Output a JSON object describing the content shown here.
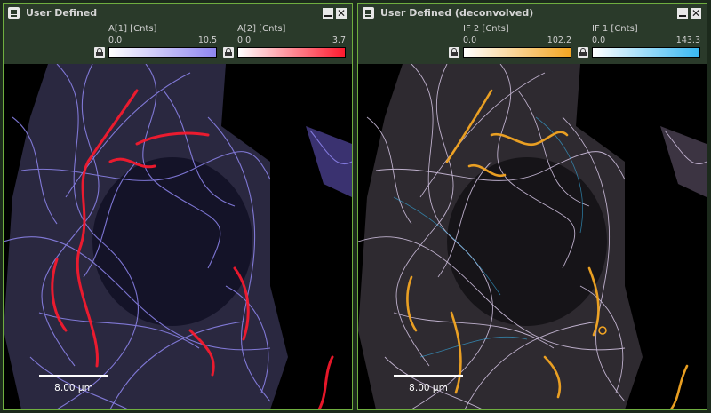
{
  "panels": [
    {
      "title": "User Defined",
      "channels": [
        {
          "name": "A[1] [Cnts]",
          "min": "0.0",
          "max": "10.5",
          "color": "#8f86f0"
        },
        {
          "name": "A[2] [Cnts]",
          "min": "0.0",
          "max": "3.7",
          "color": "#ff1a2e"
        }
      ],
      "scalebar": "8.00 µm"
    },
    {
      "title": "User Defined (deconvolved)",
      "channels": [
        {
          "name": "IF 2 [Cnts]",
          "min": "0.0",
          "max": "102.2",
          "color": "#f4a623"
        },
        {
          "name": "IF 1 [Cnts]",
          "min": "0.0",
          "max": "143.3",
          "color": "#38b8f2"
        }
      ],
      "scalebar": "8.00 µm"
    }
  ],
  "icons": {
    "menu": "menu-icon",
    "minimize": "minimize-icon",
    "close": "close-icon",
    "lock": "lock-icon"
  },
  "colors": {
    "panel_border": "#6fae3f",
    "panel_bg": "#2a3a2a",
    "cell_fill_left": "#2a2840",
    "cell_fill_right": "#2e2a30"
  }
}
